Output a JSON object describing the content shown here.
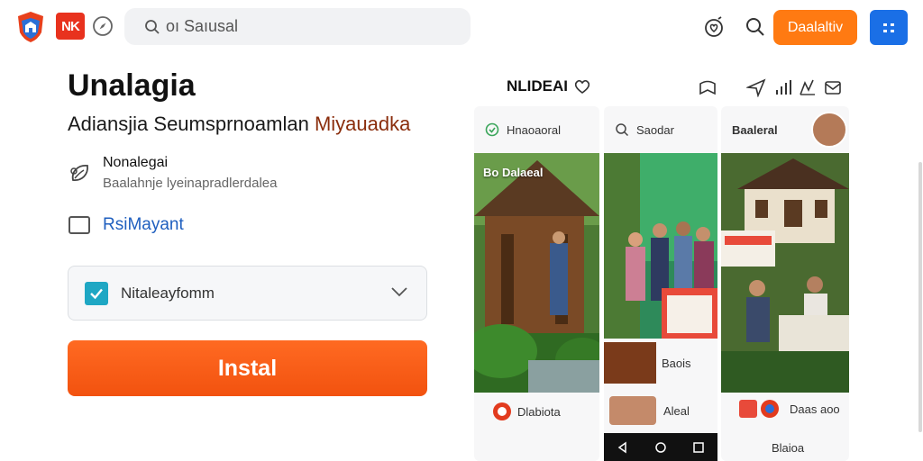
{
  "header": {
    "logo_text": "NK",
    "search_placeholder": "oı Saıusal",
    "download_label": "Daalaltiv"
  },
  "main": {
    "title": "Unalagia",
    "subtitle_plain": "Adiansjia Seumsprnoamlan ",
    "subtitle_highlight": "Miyauadka",
    "feature_title": "Nonalegai",
    "feature_desc": "Baalahnje lyeinapradlerdalea",
    "link_text": "RsiMayant",
    "select_label": "Nitaleayfomm",
    "install_label": "Instal"
  },
  "preview": {
    "title": "NLIDEAI",
    "col1": {
      "header": "Hnaoaoral",
      "photo_caption": "Bo Dalaeal",
      "footer": "Dlabiota"
    },
    "col2": {
      "header": "Saodar",
      "mid_caption": "Baois",
      "footer": "Aleal"
    },
    "col3": {
      "header": "Baaleral",
      "mid_caption": "Daas aoo",
      "footer": "Blaioa"
    }
  },
  "colors": {
    "accent_orange": "#ff7a12",
    "install_orange": "#f2520f",
    "blue": "#1a6fe6",
    "link_blue": "#1f5fbf",
    "checkbox_teal": "#1ea7c4",
    "highlight_brown": "#8a2d0c"
  },
  "icons": [
    "shield-logo-icon",
    "compass-icon",
    "search-icon",
    "bell-heart-icon",
    "search-icon",
    "grid-icon",
    "heart-icon",
    "bookmark-icon",
    "send-icon",
    "signal-icon",
    "mail-icon",
    "leaf-icon",
    "check-icon",
    "chevron-down-icon",
    "back-icon",
    "home-icon",
    "recent-icon"
  ]
}
